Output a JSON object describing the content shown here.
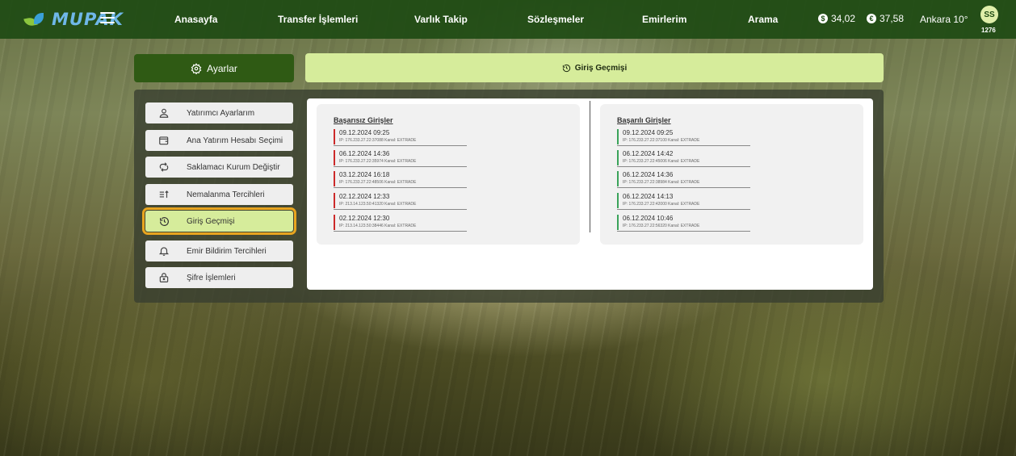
{
  "brand": {
    "logo_text": "MUPAK"
  },
  "nav": {
    "items": [
      "Anasayfa",
      "Transfer İşlemleri",
      "Varlık Takip",
      "Sözleşmeler",
      "Emirlerim",
      "Arama"
    ],
    "currencies": [
      {
        "symbol": "$",
        "value": "34,02"
      },
      {
        "symbol": "€",
        "value": "37,58"
      }
    ],
    "weather": "Ankara 10°",
    "user": {
      "initials": "SS",
      "code": "1276"
    }
  },
  "settings": {
    "tab_label": "Ayarlar",
    "header_title": "Giriş Geçmişi",
    "menu": [
      {
        "label": "Yatırımcı Ayarlarım",
        "icon": "user-icon"
      },
      {
        "label": "Ana Yatırım Hesabı Seçimi",
        "icon": "wallet-icon"
      },
      {
        "label": "Saklamacı Kurum Değiştir",
        "icon": "swap-icon"
      },
      {
        "label": "Nemalanma Tercihleri",
        "icon": "sort-icon"
      },
      {
        "label": "Giriş Geçmişi",
        "icon": "history-icon",
        "active": true
      },
      {
        "label": "Emir Bildirim Tercihleri",
        "icon": "bell-icon"
      },
      {
        "label": "Şifre İşlemleri",
        "icon": "lock-icon"
      }
    ]
  },
  "failed": {
    "title": "Başarısız Girişler",
    "entries": [
      {
        "datetime": "09.12.2024 09:25",
        "info": "IP: 176.233.27.22:37088 Kanal: EXTRADE"
      },
      {
        "datetime": "06.12.2024 14:36",
        "info": "IP: 176.233.27.22:35974 Kanal: EXTRADE"
      },
      {
        "datetime": "03.12.2024 16:18",
        "info": "IP: 176.233.27.22:48506 Kanal: EXTRADE"
      },
      {
        "datetime": "02.12.2024 12:33",
        "info": "IP: 213.14.123.50:41320 Kanal: EXTRADE"
      },
      {
        "datetime": "02.12.2024 12:30",
        "info": "IP: 213.14.123.50:38446 Kanal: EXTRADE"
      }
    ]
  },
  "success": {
    "title": "Başarılı Girişler",
    "entries": [
      {
        "datetime": "09.12.2024 09:25",
        "info": "IP: 176.233.27.22:37100 Kanal: EXTRADE"
      },
      {
        "datetime": "06.12.2024 14:42",
        "info": "IP: 176.233.27.22:45006 Kanal: EXTRADE"
      },
      {
        "datetime": "06.12.2024 14:36",
        "info": "IP: 176.233.27.22:38984 Kanal: EXTRADE"
      },
      {
        "datetime": "06.12.2024 14:13",
        "info": "IP: 176.233.27.22:42000 Kanal: EXTRADE"
      },
      {
        "datetime": "06.12.2024 10:46",
        "info": "IP: 176.233.27.22:56320 Kanal: EXTRADE"
      }
    ]
  },
  "colors": {
    "nav_bg": "#1e4b14",
    "accent": "#d6ec9b",
    "active_outline": "#e8a41f",
    "failed_marker": "#cc2a2a",
    "success_marker": "#3aa35a"
  }
}
